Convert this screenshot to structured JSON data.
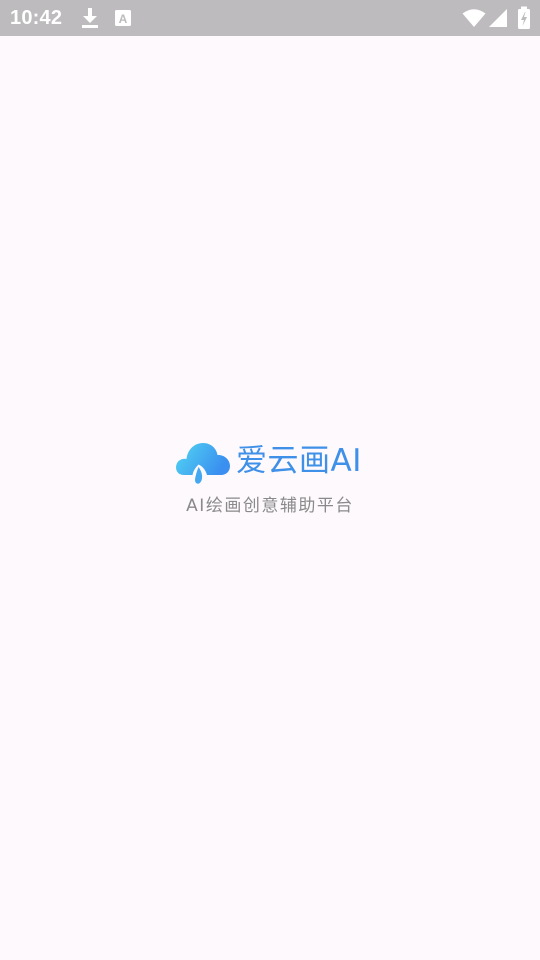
{
  "status_bar": {
    "time": "10:42",
    "background_color": "#bdbbbd",
    "icons_left": [
      "download-icon",
      "font-notification-icon"
    ],
    "font_icon_glyph": "A",
    "icons_right": [
      "wifi-icon",
      "signal-icon",
      "battery-charging-icon"
    ]
  },
  "splash": {
    "brand_name": "爱云画AI",
    "tagline": "AI绘画创意辅助平台",
    "logo_icon": "cloud-brush-logo-icon",
    "brand_color": "#3f90e8",
    "logo_gradient": [
      "#52d6f2",
      "#3a8ff0"
    ],
    "tagline_color": "#8a8a8a",
    "background_color": "#fdf9fd"
  }
}
